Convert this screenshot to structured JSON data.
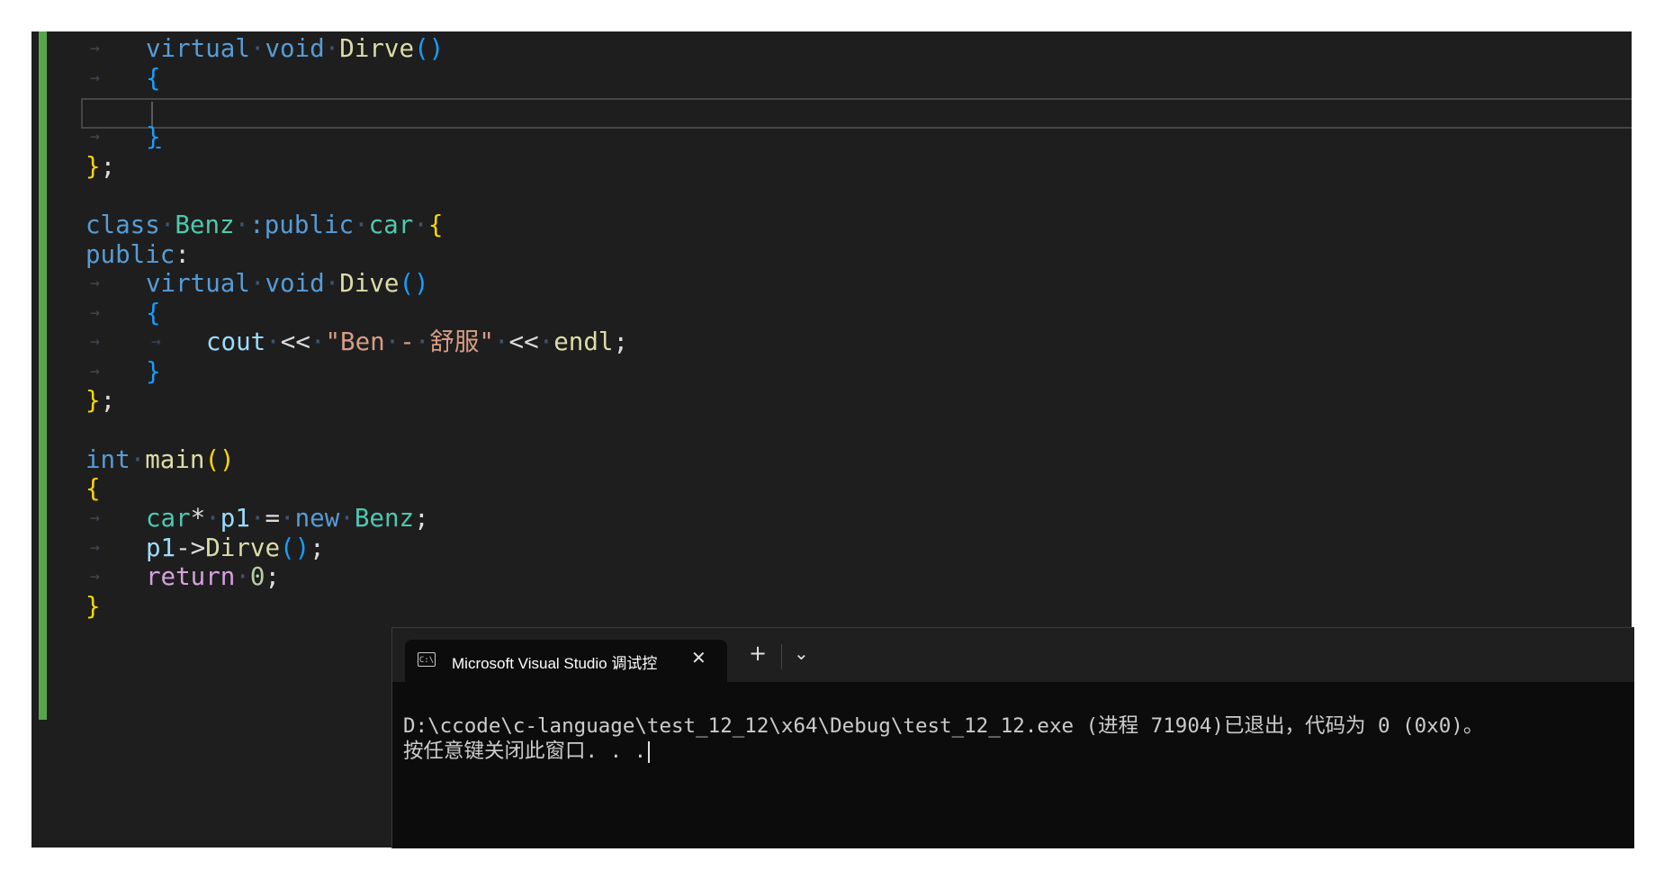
{
  "editor": {
    "lines": [
      {
        "id": "l1",
        "tokens": [
          [
            "kw",
            "virtual"
          ],
          [
            "dot",
            "·"
          ],
          [
            "kw",
            "void"
          ],
          [
            "dot",
            "·"
          ],
          [
            "fn",
            "Dirve"
          ],
          [
            "br2",
            "()"
          ]
        ]
      },
      {
        "id": "l2",
        "tokens": [
          [
            "br2",
            "{"
          ]
        ]
      },
      {
        "id": "l4",
        "tokens": [
          [
            "br2",
            "}"
          ]
        ]
      },
      {
        "id": "l5",
        "tokens": [
          [
            "br1",
            "}"
          ],
          [
            "plain",
            ";"
          ]
        ]
      },
      {
        "id": "l7",
        "tokens": [
          [
            "kw",
            "class"
          ],
          [
            "dot",
            "·"
          ],
          [
            "ty",
            "Benz"
          ],
          [
            "dot",
            "·"
          ],
          [
            "kw",
            ":public"
          ],
          [
            "dot",
            "·"
          ],
          [
            "ty",
            "car"
          ],
          [
            "dot",
            "·"
          ],
          [
            "br1",
            "{"
          ]
        ]
      },
      {
        "id": "l8",
        "tokens": [
          [
            "kw",
            "public"
          ],
          [
            "plain",
            ":"
          ]
        ]
      },
      {
        "id": "l9",
        "tokens": [
          [
            "kw",
            "virtual"
          ],
          [
            "dot",
            "·"
          ],
          [
            "kw",
            "void"
          ],
          [
            "dot",
            "·"
          ],
          [
            "fn",
            "Dive"
          ],
          [
            "br2",
            "()"
          ]
        ]
      },
      {
        "id": "l10",
        "tokens": [
          [
            "br2",
            "{"
          ]
        ]
      },
      {
        "id": "l11",
        "tokens": [
          [
            "var",
            "cout"
          ],
          [
            "dot",
            "·"
          ],
          [
            "plain",
            "<<"
          ],
          [
            "dot",
            "·"
          ],
          [
            "str",
            "\"Ben"
          ],
          [
            "dot",
            "·"
          ],
          [
            "str",
            "-"
          ],
          [
            "dot",
            "·"
          ],
          [
            "str",
            "舒服\""
          ],
          [
            "dot",
            "·"
          ],
          [
            "plain",
            "<<"
          ],
          [
            "dot",
            "·"
          ],
          [
            "fn",
            "endl"
          ],
          [
            "plain",
            ";"
          ]
        ]
      },
      {
        "id": "l12",
        "tokens": [
          [
            "br2",
            "}"
          ]
        ]
      },
      {
        "id": "l13",
        "tokens": [
          [
            "br1",
            "}"
          ],
          [
            "plain",
            ";"
          ]
        ]
      },
      {
        "id": "l15",
        "tokens": [
          [
            "kw",
            "int"
          ],
          [
            "dot",
            "·"
          ],
          [
            "fn",
            "main"
          ],
          [
            "br1",
            "()"
          ]
        ]
      },
      {
        "id": "l16",
        "tokens": [
          [
            "br1",
            "{"
          ]
        ]
      },
      {
        "id": "l17",
        "tokens": [
          [
            "ty",
            "car"
          ],
          [
            "plain",
            "*"
          ],
          [
            "dot",
            "·"
          ],
          [
            "var",
            "p1"
          ],
          [
            "dot",
            "·"
          ],
          [
            "plain",
            "="
          ],
          [
            "dot",
            "·"
          ],
          [
            "kw",
            "new"
          ],
          [
            "dot",
            "·"
          ],
          [
            "ty",
            "Benz"
          ],
          [
            "plain",
            ";"
          ]
        ]
      },
      {
        "id": "l18",
        "tokens": [
          [
            "var",
            "p1"
          ],
          [
            "plain",
            "->"
          ],
          [
            "fn",
            "Dirve"
          ],
          [
            "br2",
            "()"
          ],
          [
            "plain",
            ";"
          ]
        ]
      },
      {
        "id": "l19",
        "tokens": [
          [
            "ctrl",
            "return"
          ],
          [
            "dot",
            "·"
          ],
          [
            "num",
            "0"
          ],
          [
            "plain",
            ";"
          ]
        ]
      },
      {
        "id": "l20",
        "tokens": [
          [
            "br1",
            "}"
          ]
        ]
      }
    ]
  },
  "terminal": {
    "tab_title": "Microsoft Visual Studio 调试控",
    "tab_icon_text": "C:\\",
    "close_glyph": "✕",
    "add_glyph": "+",
    "dropdown_glyph": "⌄",
    "output_line1": "D:\\ccode\\c-language\\test_12_12\\x64\\Debug\\test_12_12.exe (进程 71904)已退出，代码为 0 (0x0)。",
    "output_line2": "按任意键关闭此窗口. . ."
  },
  "colors": {
    "editor_bg": "#1e1e1e",
    "change_bar": "#57a64a",
    "terminal_bg": "#0c0c0c"
  }
}
